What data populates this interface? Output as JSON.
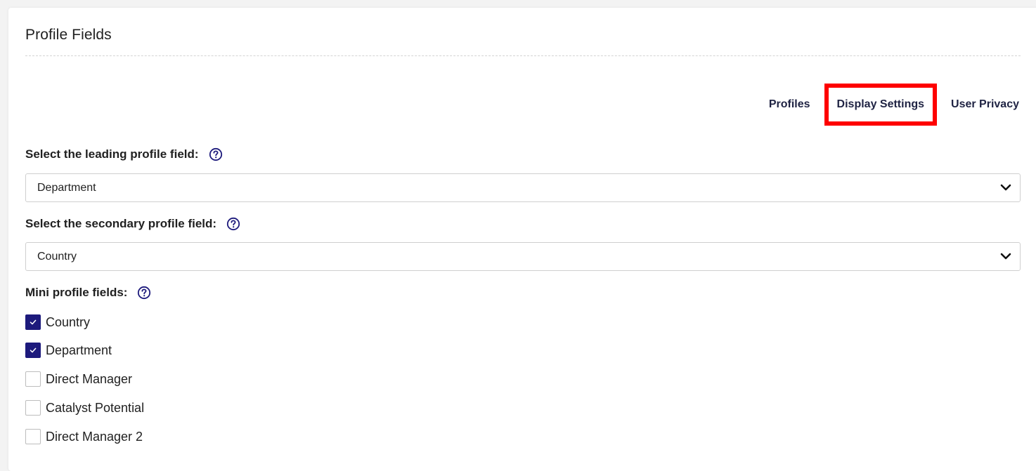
{
  "page": {
    "title": "Profile Fields"
  },
  "tabs": [
    {
      "label": "Profiles"
    },
    {
      "label": "Display Settings",
      "highlighted": true
    },
    {
      "label": "User Privacy"
    }
  ],
  "leading_field": {
    "label": "Select the leading profile field:",
    "value": "Department"
  },
  "secondary_field": {
    "label": "Select the secondary profile field:",
    "value": "Country"
  },
  "mini_profile": {
    "label": "Mini profile fields:",
    "options": [
      {
        "label": "Country",
        "checked": true
      },
      {
        "label": "Department",
        "checked": true
      },
      {
        "label": "Direct Manager",
        "checked": false
      },
      {
        "label": "Catalyst Potential",
        "checked": false
      },
      {
        "label": "Direct Manager 2",
        "checked": false
      }
    ]
  },
  "colors": {
    "accent": "#1d1a7c",
    "highlight": "#fe0000",
    "tab_text": "#1f2343"
  },
  "icons": {
    "help": "question-circle-icon",
    "dropdown": "chevron-down-icon",
    "check": "checkmark-icon"
  }
}
